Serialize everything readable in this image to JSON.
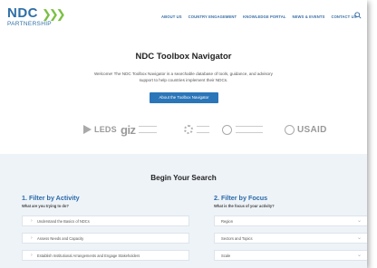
{
  "header": {
    "logo_top": "NDC",
    "logo_bottom": "PARTNERSHIP",
    "nav": [
      "ABOUT US",
      "COUNTRY ENGAGEMENT",
      "KNOWLEDGE PORTAL",
      "NEWS & EVENTS",
      "CONTACT US"
    ]
  },
  "hero": {
    "title": "NDC Toolbox Navigator",
    "description": "Welcome! The NDC Toolbox Navigator is a searchable database of tools, guidance, and advisory support to help countries implement their NDCs.",
    "button": "About the Toolbox Navigator"
  },
  "partners": {
    "leds": "LEDS",
    "giz": "giz",
    "usaid": "USAID"
  },
  "search": {
    "title": "Begin Your Search",
    "activity": {
      "title": "1. Filter by Activity",
      "subtitle": "What are you trying to do?",
      "items": [
        "Understand the Basics of NDCs",
        "Assess Needs and Capacity",
        "Establish Institutional Arrangements and Engage Stakeholders"
      ]
    },
    "focus": {
      "title": "2. Filter by Focus",
      "subtitle": "What is the focus of your activity?",
      "selects": [
        "Region",
        "Sectors and Topics",
        "Scale"
      ]
    }
  },
  "colors": {
    "brand_blue": "#2a76b9",
    "brand_green": "#7bc043",
    "section_bg": "#eef3f8"
  },
  "icons": [
    "search-icon",
    "chevron-right-icon",
    "chevron-down-icon"
  ]
}
